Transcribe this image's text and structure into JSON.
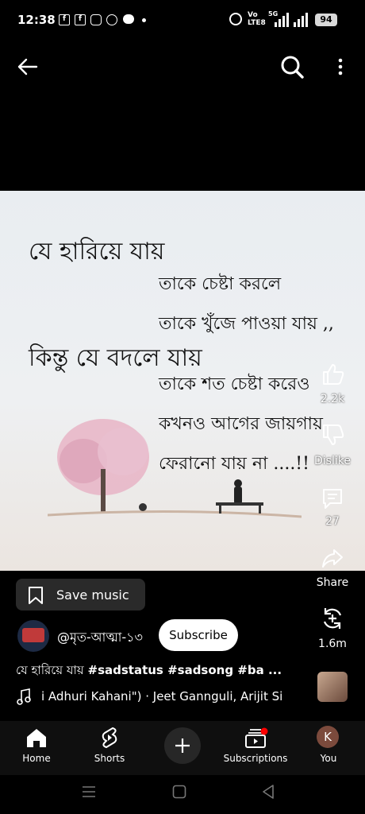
{
  "status_bar": {
    "time": "12:38",
    "network_label_top": "Vo",
    "network_label_bottom": "LTE8",
    "network_type": "5G",
    "battery": "94"
  },
  "poem": {
    "line1": "যে হারিয়ে যায়",
    "line2": "তাকে চেষ্টা করলে",
    "line3": "তাকে খুঁজে পাওয়া যায় ,,",
    "line4": "কিন্তু যে বদলে যায়",
    "line5": "তাকে শত চেষ্টা করেও",
    "line6": "কখনও আগের জায়গায়",
    "line7": "ফেরানো যায় না ....!!"
  },
  "actions": {
    "like_count": "2.2k",
    "dislike_label": "Dislike",
    "comment_count": "27",
    "share_label": "Share",
    "remix_count": "1.6m"
  },
  "save_music": {
    "label": "Save music"
  },
  "channel": {
    "name": "@মৃত-আত্মা-১৩",
    "subscribe_label": "Subscribe"
  },
  "video_title": {
    "plain": "যে হারিয়ে যায় ",
    "tags": "#sadstatus #sadsong #ba ..."
  },
  "music": {
    "text": "i Adhuri Kahani\") · Jeet Gannguli, Arijit Si"
  },
  "bottom_nav": {
    "home": "Home",
    "shorts": "Shorts",
    "subscriptions": "Subscriptions",
    "you": "You",
    "avatar_letter": "K"
  },
  "colors": {
    "accent_red": "#ff0000",
    "avatar_bg": "#7b4a3c",
    "subscribe_bg": "#ffffff"
  }
}
